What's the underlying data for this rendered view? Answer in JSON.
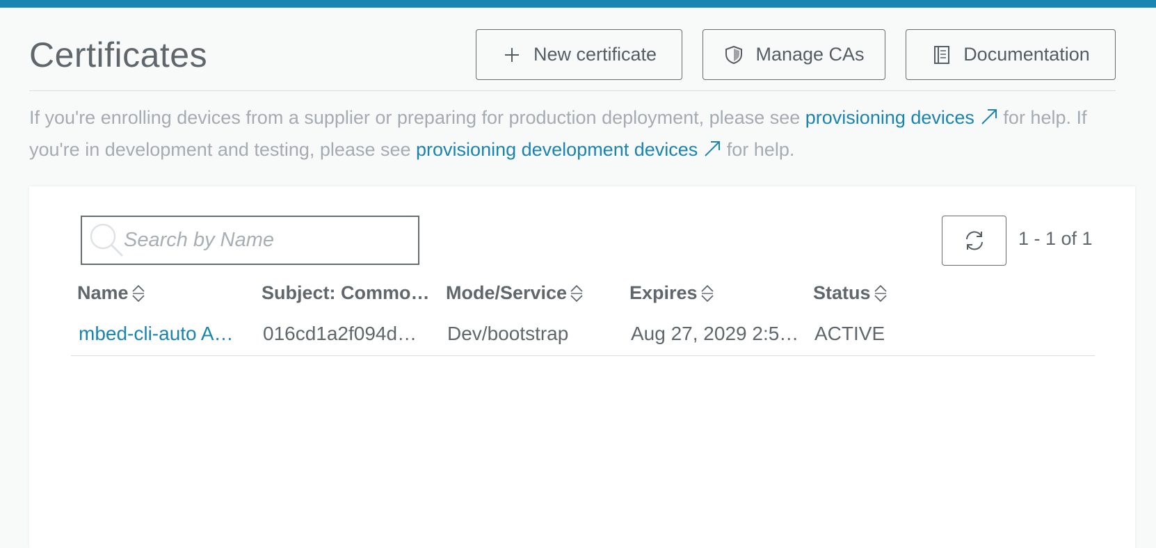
{
  "header": {
    "title": "Certificates",
    "buttons": {
      "new_certificate": "New certificate",
      "manage_cas": "Manage CAs",
      "documentation": "Documentation"
    }
  },
  "intro": {
    "text_1": "If you're enrolling devices from a supplier or preparing for production deployment, please see ",
    "link_1": "provisioning devices",
    "text_2": " for help. If you're in development and testing, please see ",
    "link_2": "provisioning development devices",
    "text_3": " for help."
  },
  "toolbar": {
    "search_placeholder": "Search by Name",
    "pagination": "1 - 1 of 1"
  },
  "table": {
    "columns": [
      "Name",
      "Subject: Commo…",
      "Mode/Service",
      "Expires",
      "Status"
    ],
    "rows": [
      {
        "name": "mbed-cli-auto A…",
        "subject": "016cd1a2f094d…",
        "mode": "Dev/bootstrap",
        "expires": "Aug 27, 2029 2:5…",
        "status": "ACTIVE"
      }
    ]
  },
  "colors": {
    "accent": "#1a85b0",
    "link": "#1a84b0",
    "text": "#5f666c",
    "muted": "#a4abb1",
    "background": "#f8f9f9"
  },
  "icons": {
    "new_certificate": "plus-icon",
    "manage_cas": "shield-icon",
    "documentation": "book-icon",
    "search": "search-icon",
    "refresh": "refresh-icon",
    "external_link": "external-arrow-icon",
    "sort": "sort-icon"
  }
}
